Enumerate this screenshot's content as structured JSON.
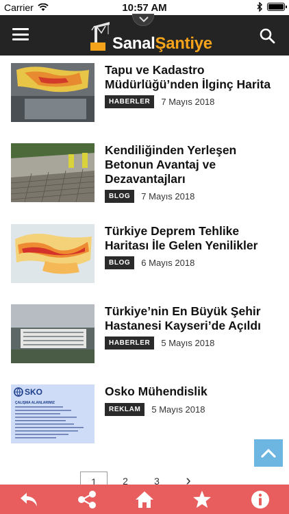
{
  "status_bar": {
    "carrier": "Carrier",
    "time": "10:57 AM"
  },
  "header": {
    "logo_part1": "Sanal",
    "logo_part2": "Şantiye",
    "accent_color": "#f4a31a"
  },
  "articles": [
    {
      "title": "Tapu ve Kadastro Müdürlüğü’nden İlginç Harita",
      "category": "HABERLER",
      "date": "7 Mayıs 2018"
    },
    {
      "title": "Kendiliğinden Yerleşen Betonun Avantaj ve Dezavantajları",
      "category": "BLOG",
      "date": "7 Mayıs 2018"
    },
    {
      "title": "Türkiye Deprem Tehlike Haritası İle Gelen Yenilikler",
      "category": "BLOG",
      "date": "6 Mayıs 2018"
    },
    {
      "title": "Türkiye’nin En Büyük Şehir Hastanesi Kayseri’de Açıldı",
      "category": "HABERLER",
      "date": "5 Mayıs 2018"
    },
    {
      "title": "Osko Mühendislik",
      "category": "REKLAM",
      "date": "5 Mayıs 2018"
    }
  ],
  "thumb_text": {
    "osko_logo": "SKO",
    "osko_heading": "ÇALIŞMA ALANLARIMIZ"
  },
  "pagination": {
    "pages": [
      "1",
      "2",
      "3"
    ],
    "next": "›"
  },
  "bottom_bar": {
    "icons": [
      "back-icon",
      "share-icon",
      "home-icon",
      "star-icon",
      "info-icon"
    ],
    "color": "#e85d5d"
  }
}
